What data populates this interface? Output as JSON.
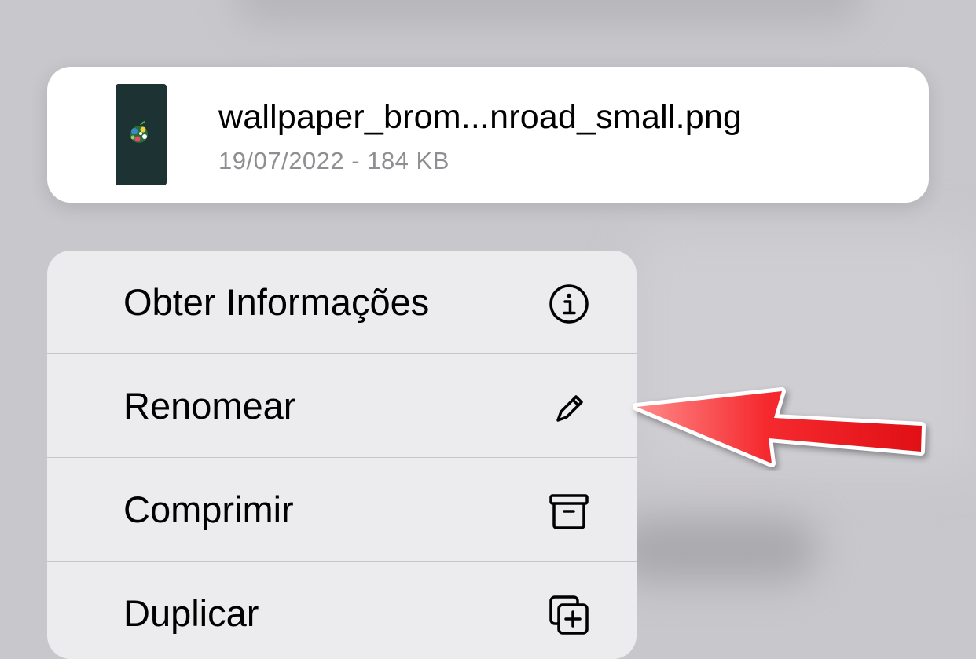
{
  "file": {
    "name": "wallpaper_brom...nroad_small.png",
    "meta": "19/07/2022 - 184 KB",
    "thumbnail_icon": "wallpaper-thumbnail"
  },
  "menu": {
    "items": [
      {
        "label": "Obter Informações",
        "icon": "info-circle-icon"
      },
      {
        "label": "Renomear",
        "icon": "pencil-icon"
      },
      {
        "label": "Comprimir",
        "icon": "archive-box-icon"
      },
      {
        "label": "Duplicar",
        "icon": "duplicate-plus-icon"
      }
    ]
  },
  "annotation": {
    "arrow_color": "#f0161b",
    "arrow_points_to": "Renomear"
  }
}
